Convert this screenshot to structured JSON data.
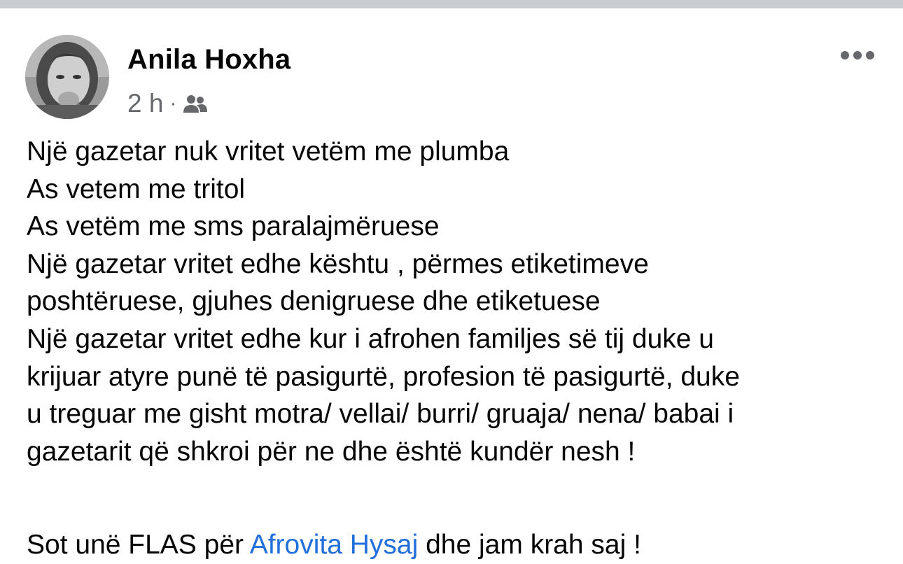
{
  "post": {
    "author_name": "Anila Hoxha",
    "timestamp": "2 h",
    "separator": "·",
    "audience_icon": "friends-icon",
    "more_icon": "more-options-icon",
    "lines": [
      "Një gazetar nuk vritet vetëm me plumba",
      "As vetem me tritol",
      "As vetëm me sms paralajmëruese",
      "Një gazetar vritet edhe kështu , përmes etiketimeve",
      "poshtëruese, gjuhes denigruese dhe etiketuese",
      "Një gazetar vritet edhe kur i afrohen familjes së tij duke u",
      "krijuar atyre punë të pasigurtë, profesion të pasigurtë, duke",
      "u treguar me gisht motra/ vellai/ burri/ gruaja/ nena/ babai i",
      "gazetarit që shkroi për ne dhe është kundër nesh !"
    ],
    "last_line": {
      "before": "Sot unë FLAS për ",
      "mention": "Afrovita Hysaj",
      "after": " dhe jam krah saj !"
    }
  },
  "colors": {
    "text": "#050505",
    "secondary_text": "#65676b",
    "link": "#216fdb",
    "divider_strip": "#c9ccd1"
  }
}
